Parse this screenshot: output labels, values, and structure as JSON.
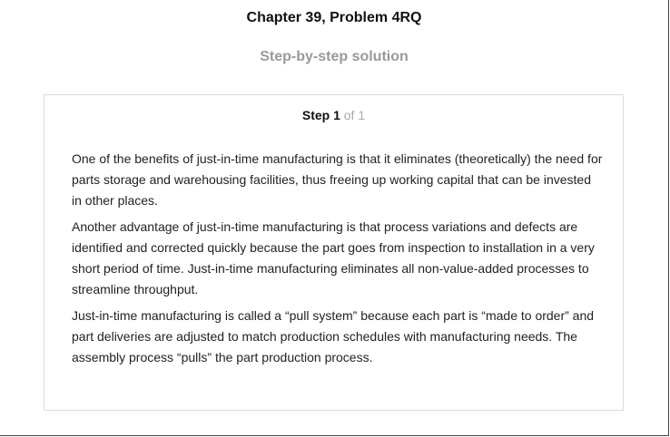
{
  "header": {
    "title": "Chapter 39, Problem 4RQ",
    "subtitle": "Step-by-step solution"
  },
  "step": {
    "label": "Step 1",
    "of": "of 1"
  },
  "paragraphs": [
    "One of the benefits of just-in-time manufacturing is that it eliminates (theoretically) the need for parts storage and warehousing facilities, thus freeing up working capital that can be invested in other places.",
    "Another advantage of just-in-time manufacturing is that process variations and defects are identified and corrected quickly because the part goes from inspection to installation in a very short period of time. Just-in-time manufacturing eliminates all non-value-added processes to streamline throughput.",
    "Just-in-time manufacturing is called a “pull system” because each part is “made to order” and part deliveries are adjusted to match production schedules with manufacturing needs. The assembly process “pulls” the part production process."
  ]
}
